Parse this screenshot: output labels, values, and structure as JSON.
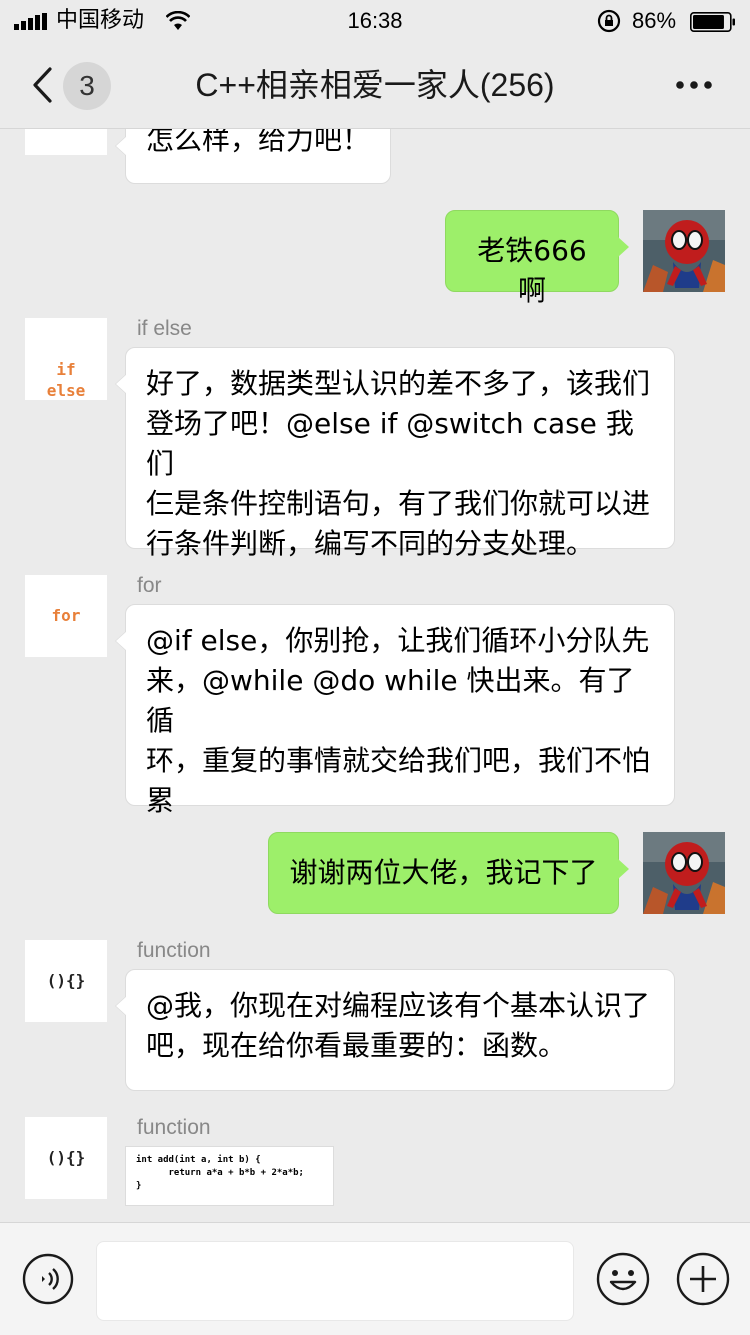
{
  "status_bar": {
    "carrier": "中国移动",
    "time": "16:38",
    "battery_percent": "86%",
    "battery_level": 0.86
  },
  "nav": {
    "unread_count": "3",
    "title": "C++相亲相爱一家人(256)"
  },
  "messages": [
    {
      "side": "left",
      "avatar_text": "{}",
      "text": "怎么样，给力吧！"
    },
    {
      "side": "right",
      "text": "老铁666啊"
    },
    {
      "side": "left",
      "sender": "if else",
      "avatar_text": "if\nelse",
      "avatar_color": "#e8803a",
      "text": "好了，数据类型认识的差不多了，该我们\n登场了吧！@else if @switch case 我们\n仨是条件控制语句，有了我们你就可以进\n行条件判断，编写不同的分支处理。"
    },
    {
      "side": "left",
      "sender": "for",
      "avatar_text": "for",
      "avatar_color": "#e8803a",
      "text": "@if else，你别抢，让我们循环小分队先\n来，@while @do while 快出来。有了循\n环，重复的事情就交给我们吧，我们不怕\n累"
    },
    {
      "side": "right",
      "text": "谢谢两位大佬，我记下了"
    },
    {
      "side": "left",
      "sender": "function",
      "avatar_text": "(){}",
      "avatar_color": "#222222",
      "text": "@我，你现在对编程应该有个基本认识了\n吧，现在给你看最重要的：函数。"
    },
    {
      "side": "left",
      "sender": "function",
      "avatar_text": "(){}",
      "avatar_color": "#222222",
      "code": "int add(int a, int b) {\n      return a*a + b*b + 2*a*b;\n}"
    }
  ],
  "colors": {
    "sent_bubble": "#9def6a",
    "background": "#ebebeb",
    "accent_orange": "#e8803a"
  }
}
